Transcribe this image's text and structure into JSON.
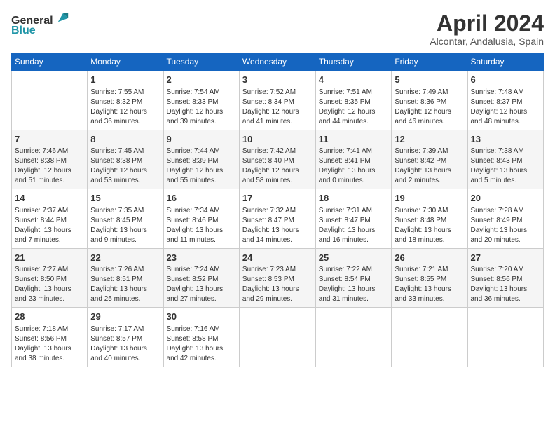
{
  "logo": {
    "line1": "General",
    "line2": "Blue"
  },
  "title": "April 2024",
  "subtitle": "Alcontar, Andalusia, Spain",
  "days_header": [
    "Sunday",
    "Monday",
    "Tuesday",
    "Wednesday",
    "Thursday",
    "Friday",
    "Saturday"
  ],
  "weeks": [
    [
      {
        "day": "",
        "sunrise": "",
        "sunset": "",
        "daylight": ""
      },
      {
        "day": "1",
        "sunrise": "Sunrise: 7:55 AM",
        "sunset": "Sunset: 8:32 PM",
        "daylight": "Daylight: 12 hours and 36 minutes."
      },
      {
        "day": "2",
        "sunrise": "Sunrise: 7:54 AM",
        "sunset": "Sunset: 8:33 PM",
        "daylight": "Daylight: 12 hours and 39 minutes."
      },
      {
        "day": "3",
        "sunrise": "Sunrise: 7:52 AM",
        "sunset": "Sunset: 8:34 PM",
        "daylight": "Daylight: 12 hours and 41 minutes."
      },
      {
        "day": "4",
        "sunrise": "Sunrise: 7:51 AM",
        "sunset": "Sunset: 8:35 PM",
        "daylight": "Daylight: 12 hours and 44 minutes."
      },
      {
        "day": "5",
        "sunrise": "Sunrise: 7:49 AM",
        "sunset": "Sunset: 8:36 PM",
        "daylight": "Daylight: 12 hours and 46 minutes."
      },
      {
        "day": "6",
        "sunrise": "Sunrise: 7:48 AM",
        "sunset": "Sunset: 8:37 PM",
        "daylight": "Daylight: 12 hours and 48 minutes."
      }
    ],
    [
      {
        "day": "7",
        "sunrise": "Sunrise: 7:46 AM",
        "sunset": "Sunset: 8:38 PM",
        "daylight": "Daylight: 12 hours and 51 minutes."
      },
      {
        "day": "8",
        "sunrise": "Sunrise: 7:45 AM",
        "sunset": "Sunset: 8:38 PM",
        "daylight": "Daylight: 12 hours and 53 minutes."
      },
      {
        "day": "9",
        "sunrise": "Sunrise: 7:44 AM",
        "sunset": "Sunset: 8:39 PM",
        "daylight": "Daylight: 12 hours and 55 minutes."
      },
      {
        "day": "10",
        "sunrise": "Sunrise: 7:42 AM",
        "sunset": "Sunset: 8:40 PM",
        "daylight": "Daylight: 12 hours and 58 minutes."
      },
      {
        "day": "11",
        "sunrise": "Sunrise: 7:41 AM",
        "sunset": "Sunset: 8:41 PM",
        "daylight": "Daylight: 13 hours and 0 minutes."
      },
      {
        "day": "12",
        "sunrise": "Sunrise: 7:39 AM",
        "sunset": "Sunset: 8:42 PM",
        "daylight": "Daylight: 13 hours and 2 minutes."
      },
      {
        "day": "13",
        "sunrise": "Sunrise: 7:38 AM",
        "sunset": "Sunset: 8:43 PM",
        "daylight": "Daylight: 13 hours and 5 minutes."
      }
    ],
    [
      {
        "day": "14",
        "sunrise": "Sunrise: 7:37 AM",
        "sunset": "Sunset: 8:44 PM",
        "daylight": "Daylight: 13 hours and 7 minutes."
      },
      {
        "day": "15",
        "sunrise": "Sunrise: 7:35 AM",
        "sunset": "Sunset: 8:45 PM",
        "daylight": "Daylight: 13 hours and 9 minutes."
      },
      {
        "day": "16",
        "sunrise": "Sunrise: 7:34 AM",
        "sunset": "Sunset: 8:46 PM",
        "daylight": "Daylight: 13 hours and 11 minutes."
      },
      {
        "day": "17",
        "sunrise": "Sunrise: 7:32 AM",
        "sunset": "Sunset: 8:47 PM",
        "daylight": "Daylight: 13 hours and 14 minutes."
      },
      {
        "day": "18",
        "sunrise": "Sunrise: 7:31 AM",
        "sunset": "Sunset: 8:47 PM",
        "daylight": "Daylight: 13 hours and 16 minutes."
      },
      {
        "day": "19",
        "sunrise": "Sunrise: 7:30 AM",
        "sunset": "Sunset: 8:48 PM",
        "daylight": "Daylight: 13 hours and 18 minutes."
      },
      {
        "day": "20",
        "sunrise": "Sunrise: 7:28 AM",
        "sunset": "Sunset: 8:49 PM",
        "daylight": "Daylight: 13 hours and 20 minutes."
      }
    ],
    [
      {
        "day": "21",
        "sunrise": "Sunrise: 7:27 AM",
        "sunset": "Sunset: 8:50 PM",
        "daylight": "Daylight: 13 hours and 23 minutes."
      },
      {
        "day": "22",
        "sunrise": "Sunrise: 7:26 AM",
        "sunset": "Sunset: 8:51 PM",
        "daylight": "Daylight: 13 hours and 25 minutes."
      },
      {
        "day": "23",
        "sunrise": "Sunrise: 7:24 AM",
        "sunset": "Sunset: 8:52 PM",
        "daylight": "Daylight: 13 hours and 27 minutes."
      },
      {
        "day": "24",
        "sunrise": "Sunrise: 7:23 AM",
        "sunset": "Sunset: 8:53 PM",
        "daylight": "Daylight: 13 hours and 29 minutes."
      },
      {
        "day": "25",
        "sunrise": "Sunrise: 7:22 AM",
        "sunset": "Sunset: 8:54 PM",
        "daylight": "Daylight: 13 hours and 31 minutes."
      },
      {
        "day": "26",
        "sunrise": "Sunrise: 7:21 AM",
        "sunset": "Sunset: 8:55 PM",
        "daylight": "Daylight: 13 hours and 33 minutes."
      },
      {
        "day": "27",
        "sunrise": "Sunrise: 7:20 AM",
        "sunset": "Sunset: 8:56 PM",
        "daylight": "Daylight: 13 hours and 36 minutes."
      }
    ],
    [
      {
        "day": "28",
        "sunrise": "Sunrise: 7:18 AM",
        "sunset": "Sunset: 8:56 PM",
        "daylight": "Daylight: 13 hours and 38 minutes."
      },
      {
        "day": "29",
        "sunrise": "Sunrise: 7:17 AM",
        "sunset": "Sunset: 8:57 PM",
        "daylight": "Daylight: 13 hours and 40 minutes."
      },
      {
        "day": "30",
        "sunrise": "Sunrise: 7:16 AM",
        "sunset": "Sunset: 8:58 PM",
        "daylight": "Daylight: 13 hours and 42 minutes."
      },
      {
        "day": "",
        "sunrise": "",
        "sunset": "",
        "daylight": ""
      },
      {
        "day": "",
        "sunrise": "",
        "sunset": "",
        "daylight": ""
      },
      {
        "day": "",
        "sunrise": "",
        "sunset": "",
        "daylight": ""
      },
      {
        "day": "",
        "sunrise": "",
        "sunset": "",
        "daylight": ""
      }
    ]
  ]
}
